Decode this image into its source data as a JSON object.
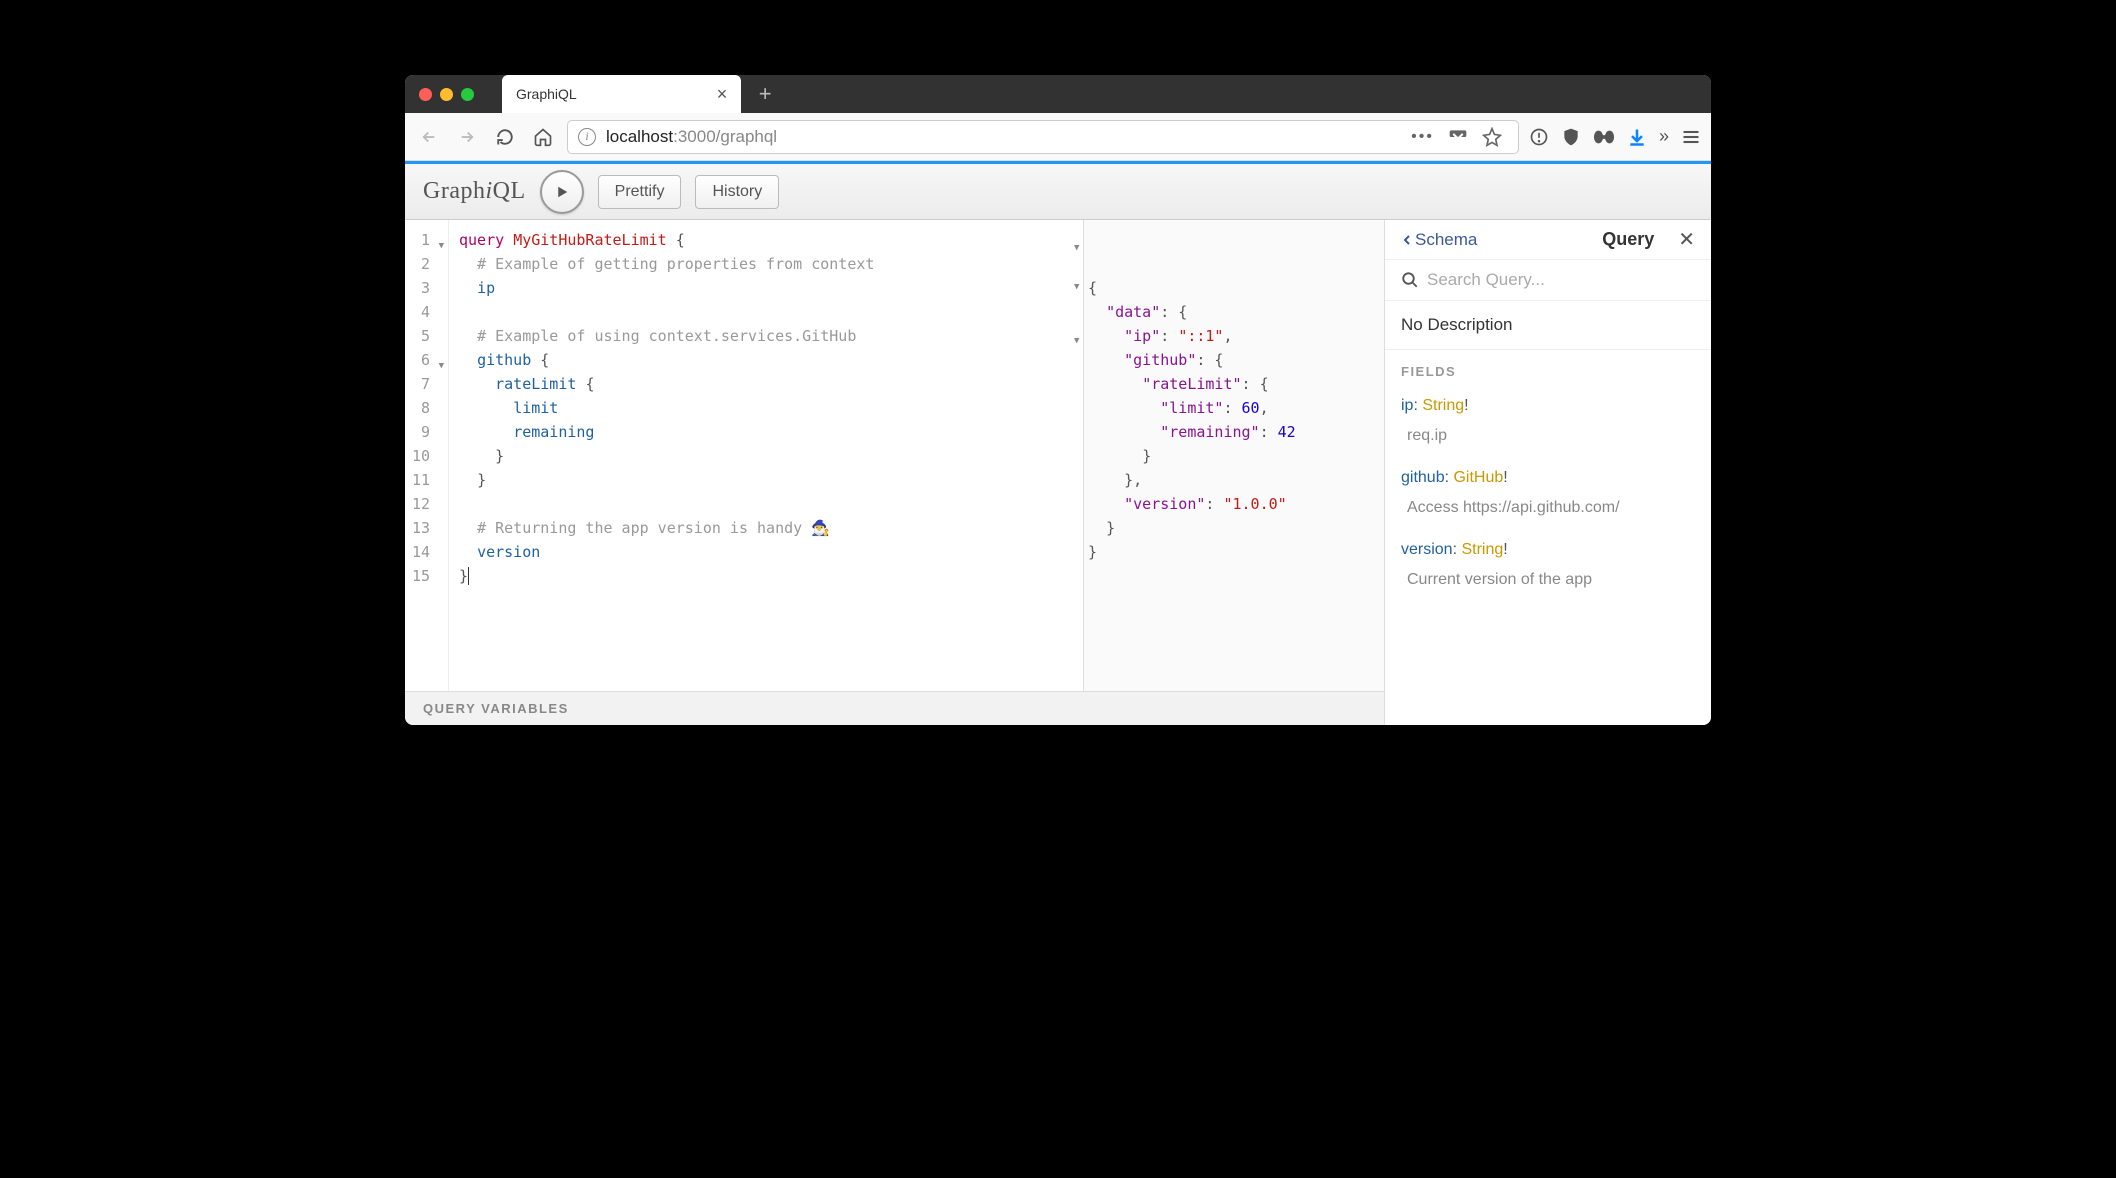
{
  "browser": {
    "tab_title": "GraphiQL",
    "url_host": "localhost",
    "url_port_path": ":3000/graphql"
  },
  "toolbar": {
    "logo_a": "Graph",
    "logo_i": "i",
    "logo_b": "QL",
    "prettify": "Prettify",
    "history": "History"
  },
  "editor": {
    "lines": [
      "1",
      "2",
      "3",
      "4",
      "5",
      "6",
      "7",
      "8",
      "9",
      "10",
      "11",
      "12",
      "13",
      "14",
      "15"
    ]
  },
  "query": {
    "l1_kw": "query",
    "l1_name": "MyGitHubRateLimit",
    "l2_comment": "# Example of getting properties from context",
    "l3_field": "ip",
    "l5_comment": "# Example of using context.services.GitHub",
    "l6_field": "github",
    "l7_field": "rateLimit",
    "l8_field": "limit",
    "l9_field": "remaining",
    "l13_comment": "# Returning the app version is handy 🧙‍♂️",
    "l14_field": "version"
  },
  "result": {
    "data_key": "\"data\"",
    "ip_key": "\"ip\"",
    "ip_val": "\"::1\"",
    "github_key": "\"github\"",
    "ratelimit_key": "\"rateLimit\"",
    "limit_key": "\"limit\"",
    "limit_val": "60",
    "remaining_key": "\"remaining\"",
    "remaining_val": "42",
    "version_key": "\"version\"",
    "version_val": "\"1.0.0\""
  },
  "variables_label": "QUERY VARIABLES",
  "docs": {
    "back": "Schema",
    "title": "Query",
    "search_placeholder": "Search Query...",
    "description": "No Description",
    "fields_label": "FIELDS",
    "fields": [
      {
        "name": "ip",
        "type": "String",
        "required": "!",
        "desc": "req.ip"
      },
      {
        "name": "github",
        "type": "GitHub",
        "required": "!",
        "desc": "Access https://api.github.com/"
      },
      {
        "name": "version",
        "type": "String",
        "required": "!",
        "desc": "Current version of the app"
      }
    ]
  }
}
